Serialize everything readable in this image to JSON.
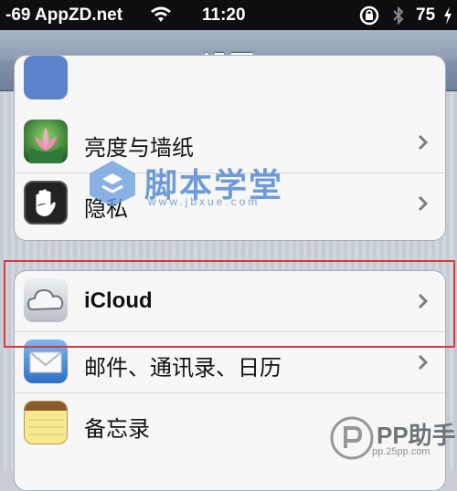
{
  "statusbar": {
    "carrier": "-69 AppZD.net",
    "time": "11:20",
    "battery": "75"
  },
  "navbar": {
    "title": "设置"
  },
  "group1": {
    "rows": [
      {
        "label": "亮度与墙纸",
        "icon": "brightness-wallpaper-icon"
      },
      {
        "label": "隐私",
        "icon": "privacy-hand-icon"
      }
    ]
  },
  "group2": {
    "rows": [
      {
        "label": "iCloud",
        "icon": "icloud-icon"
      },
      {
        "label": "邮件、通讯录、日历",
        "icon": "mail-icon"
      },
      {
        "label": "备忘录",
        "icon": "notes-icon"
      }
    ]
  },
  "watermark": {
    "text": "脚本学堂",
    "sub": "www.jbxue.com"
  },
  "corner_badge": {
    "text": "PP助手",
    "sub": "pp.25pp.com"
  }
}
